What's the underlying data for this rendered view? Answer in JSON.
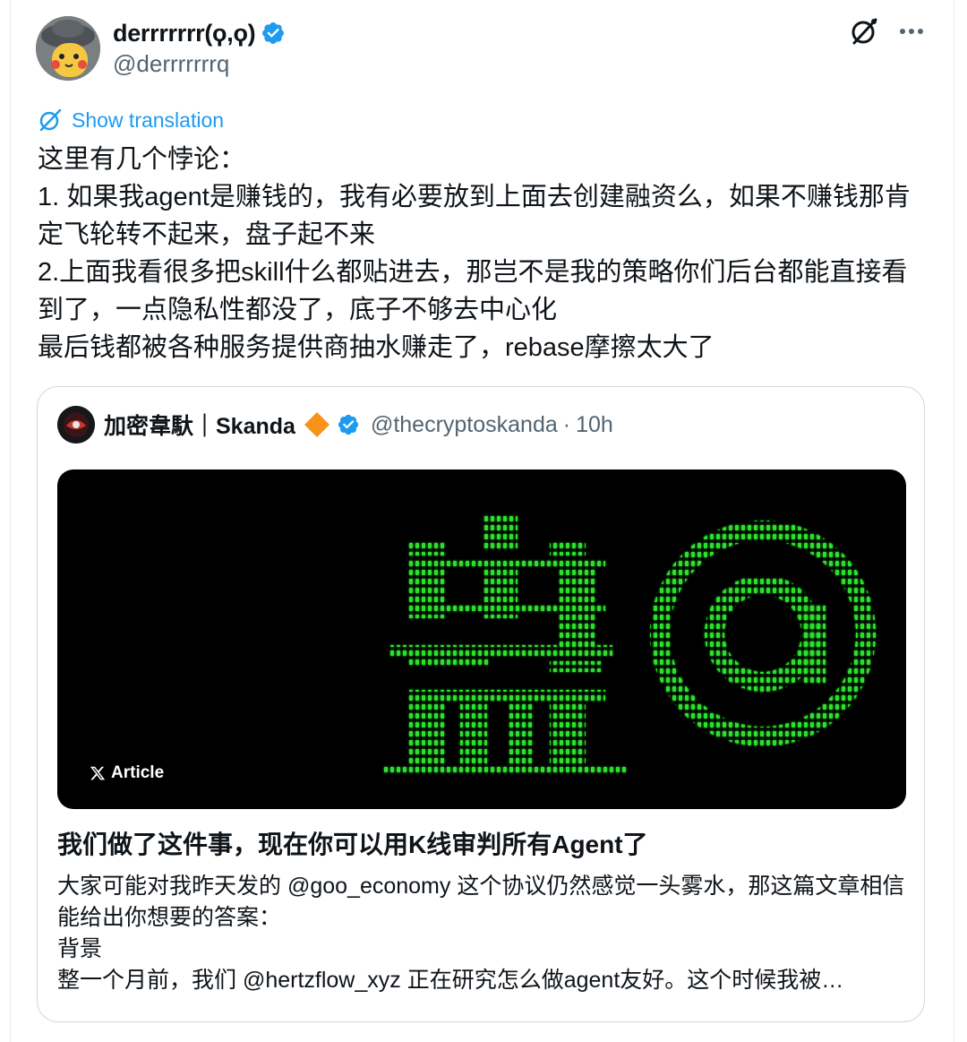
{
  "author": {
    "display_name": "derrrrrrr(ϙ,ϙ)",
    "handle": "@derrrrrrrq",
    "verified_icon": "verified-badge-icon",
    "avatar": "pikachu-with-hat-avatar"
  },
  "actions": {
    "grok_icon": "grok-icon",
    "more_icon": "more-icon"
  },
  "show_translation": "Show translation",
  "tweet_text": "这里有几个悖论：\n1. 如果我agent是赚钱的，我有必要放到上面去创建融资么，如果不赚钱那肯定飞轮转不起来，盘子起不来\n2.上面我看很多把skill什么都贴进去，那岂不是我的策略你们后台都能直接看到了，一点隐私性都没了，底子不够去中心化\n最后钱都被各种服务提供商抽水赚走了，rebase摩擦太大了",
  "quote": {
    "author_name": "加密韋馱｜Skanda",
    "handle": "@thecryptoskanda",
    "separator": "·",
    "time": "10h",
    "badge_icons": [
      "orange-diamond-icon",
      "verified-badge-icon"
    ],
    "article_badge": "Article",
    "article_image": {
      "description_icon": "ascii-art-pan-and-at-sign",
      "accent_color": "#2be02b"
    },
    "article_title": "我们做了这件事，现在你可以用K线审判所有Agent了",
    "article_body": "大家可能对我昨天发的 @goo_economy 这个协议仍然感觉一头雾水，那这篇文章相信能给出你想要的答案：\n背景\n整一个月前，我们 @hertzflow_xyz 正在研究怎么做agent友好。这个时候我被…"
  },
  "colors": {
    "link": "#1d9bf0",
    "secondary_text": "#536471",
    "verified": "#1d9bf0",
    "diamond": "#f7931a",
    "ascii_green": "#2be02b"
  }
}
